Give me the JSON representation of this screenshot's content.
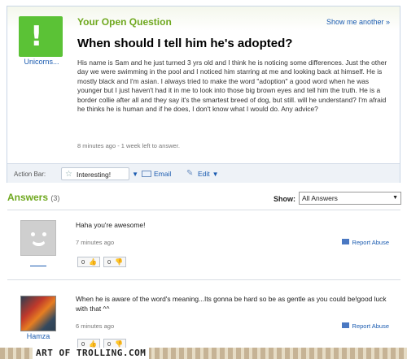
{
  "question": {
    "label": "Your Open Question",
    "show_another": "Show me another »",
    "user": "Unicorns...",
    "title": "When should I tell him he's adopted?",
    "body": "His name is Sam and he just turned 3 yrs old and I think he is noticing some differences. Just the other day we were swimming in the pool and I noticed him starring at me and looking back at himself. He is mostly black and I'm asian. I always tried to make the word \"adoption\" a good word when he was younger but I just haven't had it in me to look into those big brown eyes and tell him the truth. He is a border collie after all and they say it's the smartest breed of dog, but still. will he understand? I'm afraid he thinks he is human and if he does, I don't know what I would do. Any advice?",
    "meta": "8 minutes ago - 1 week left to answer.",
    "avatar_glyph": "!"
  },
  "action_bar": {
    "label": "Action Bar:",
    "interesting": "Interesting!",
    "email": "Email",
    "edit": "Edit"
  },
  "answers_header": {
    "title": "Answers",
    "count": "(3)",
    "show_label": "Show:",
    "show_value": "All Answers"
  },
  "answers": [
    {
      "user": "",
      "avatar": "smiley-avatar",
      "text": "Haha you're awesome!",
      "time": "7 minutes ago",
      "report": "Report Abuse",
      "thumbs_up": "0",
      "thumbs_down": "0"
    },
    {
      "user": "Hamza",
      "avatar": "photo-avatar",
      "text": "When he is aware of the word's meaning...Its gonna be hard so be as gentle as you could be!good luck with that ^^",
      "time": "6 minutes ago",
      "report": "Report Abuse",
      "thumbs_up": "0",
      "thumbs_down": "0"
    }
  ],
  "watermark": "ART OF TROLLING.COM",
  "colors": {
    "accent_green": "#6fa81f",
    "link_blue": "#1a5bb0",
    "avatar_green": "#5bc236"
  }
}
